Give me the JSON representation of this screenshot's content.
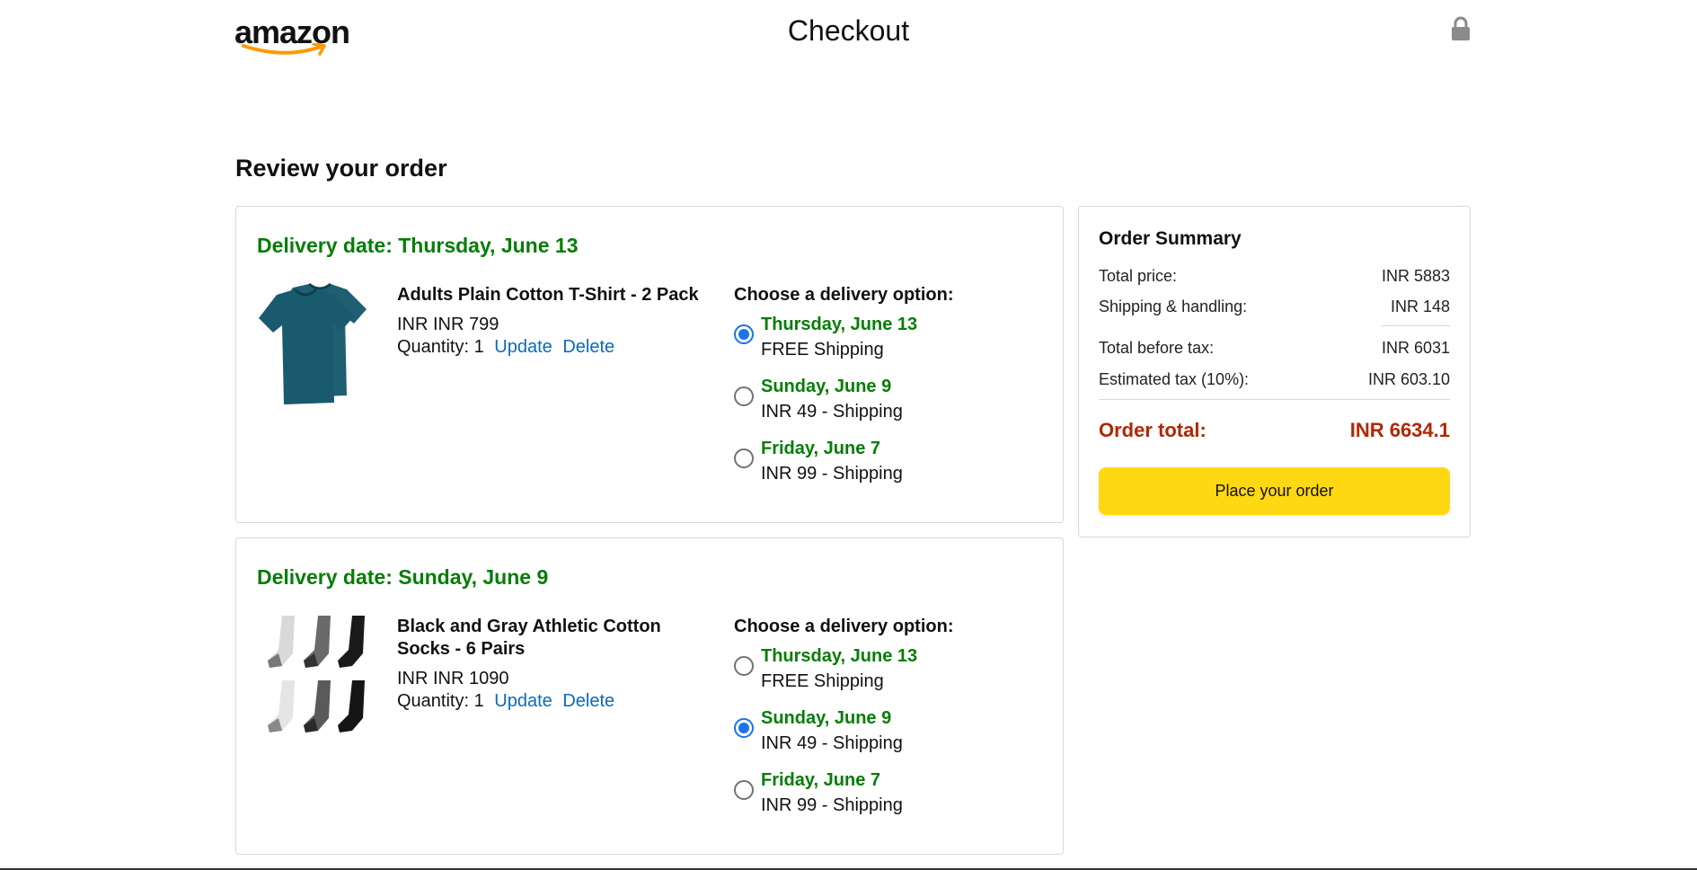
{
  "header": {
    "logo_text": "amazon",
    "title": "Checkout",
    "lock_icon": "lock-icon"
  },
  "review_title": "Review your order",
  "orders": [
    {
      "delivery_date": "Delivery date: Thursday, June 13",
      "product_name": "Adults Plain Cotton T-Shirt - 2 Pack",
      "price": "INR INR 799",
      "quantity": "Quantity: 1",
      "update_label": "Update",
      "delete_label": "Delete",
      "options_title": "Choose a delivery option:",
      "options": [
        {
          "date": "Thursday, June 13",
          "shipping": "FREE Shipping",
          "selected": true
        },
        {
          "date": "Sunday, June 9",
          "shipping": "INR 49 - Shipping",
          "selected": false
        },
        {
          "date": "Friday, June 7",
          "shipping": "INR 99 - Shipping",
          "selected": false
        }
      ]
    },
    {
      "delivery_date": "Delivery date: Sunday, June 9",
      "product_name": "Black and Gray Athletic Cotton Socks - 6 Pairs",
      "price": "INR INR 1090",
      "quantity": "Quantity: 1",
      "update_label": "Update",
      "delete_label": "Delete",
      "options_title": "Choose a delivery option:",
      "options": [
        {
          "date": "Thursday, June 13",
          "shipping": "FREE Shipping",
          "selected": false
        },
        {
          "date": "Sunday, June 9",
          "shipping": "INR 49 - Shipping",
          "selected": true
        },
        {
          "date": "Friday, June 7",
          "shipping": "INR 99 - Shipping",
          "selected": false
        }
      ]
    }
  ],
  "summary": {
    "title": "Order Summary",
    "total_price_label": "Total price:",
    "total_price": "INR 5883",
    "shipping_label": "Shipping & handling:",
    "shipping": "INR 148",
    "before_tax_label": "Total before tax:",
    "before_tax": "INR 6031",
    "tax_label": "Estimated tax (10%):",
    "tax": "INR 603.10",
    "order_total_label": "Order total:",
    "order_total": "INR 6634.1",
    "place_order_label": "Place your order"
  },
  "colors": {
    "green": "#067d06",
    "link": "#0a6bb7",
    "total_red": "#b12704",
    "button_yellow": "#ffd814",
    "radio_blue": "#1a73e8"
  }
}
